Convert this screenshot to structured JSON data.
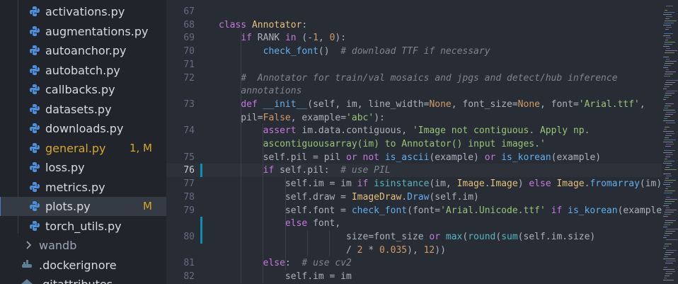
{
  "explorer": {
    "files": [
      {
        "name": "activations.py",
        "status": "",
        "color": "#d7dae0"
      },
      {
        "name": "augmentations.py",
        "status": "",
        "color": "#d7dae0"
      },
      {
        "name": "autoanchor.py",
        "status": "",
        "color": "#d7dae0"
      },
      {
        "name": "autobatch.py",
        "status": "",
        "color": "#d7dae0"
      },
      {
        "name": "callbacks.py",
        "status": "",
        "color": "#d7dae0"
      },
      {
        "name": "datasets.py",
        "status": "",
        "color": "#d7dae0"
      },
      {
        "name": "downloads.py",
        "status": "",
        "color": "#d7dae0"
      },
      {
        "name": "general.py",
        "status": "1, M",
        "color": "#d4a72c"
      },
      {
        "name": "loss.py",
        "status": "",
        "color": "#d7dae0"
      },
      {
        "name": "metrics.py",
        "status": "",
        "color": "#d7dae0"
      },
      {
        "name": "plots.py",
        "status": "M",
        "color": "#d7dae0"
      },
      {
        "name": "torch_utils.py",
        "status": "",
        "color": "#d7dae0"
      }
    ],
    "folder": "wandb",
    "dockerignore": ".dockerignore",
    "gitattributes": ".gitattributes"
  },
  "editor": {
    "current_line": "76",
    "lines": [
      {
        "num": "67",
        "parts": []
      },
      {
        "num": "68",
        "parts": [
          [
            "kw",
            "class "
          ],
          [
            "cl",
            "Annotator"
          ],
          [
            "tx",
            ":"
          ]
        ]
      },
      {
        "num": "69",
        "parts": [
          [
            "tx",
            "    "
          ],
          [
            "kw",
            "if "
          ],
          [
            "tx",
            "RANK "
          ],
          [
            "kw",
            "in "
          ],
          [
            "tx",
            "(-"
          ],
          [
            "nm",
            "1"
          ],
          [
            "tx",
            ", "
          ],
          [
            "nm",
            "0"
          ],
          [
            "tx",
            "):"
          ]
        ]
      },
      {
        "num": "70",
        "parts": [
          [
            "tx",
            "        "
          ],
          [
            "fn",
            "check_font"
          ],
          [
            "tx",
            "()  "
          ],
          [
            "cm",
            "# download TTF if necessary"
          ]
        ]
      },
      {
        "num": "71",
        "parts": []
      },
      {
        "num": "72",
        "parts": [
          [
            "tx",
            "    "
          ],
          [
            "cm",
            "#  Annotator for train/val mosaics and jpgs and detect/hub inference"
          ]
        ]
      },
      {
        "num": "",
        "parts": [
          [
            "tx",
            "    "
          ],
          [
            "cm",
            "annotations"
          ]
        ]
      },
      {
        "num": "73",
        "parts": [
          [
            "tx",
            "    "
          ],
          [
            "kw",
            "def "
          ],
          [
            "fn",
            "__init__"
          ],
          [
            "tx",
            "(self, im, line_width="
          ],
          [
            "nm",
            "None"
          ],
          [
            "tx",
            ", font_size="
          ],
          [
            "nm",
            "None"
          ],
          [
            "tx",
            ", font="
          ],
          [
            "st",
            "'Arial.ttf'"
          ],
          [
            "tx",
            ","
          ]
        ]
      },
      {
        "num": "",
        "parts": [
          [
            "tx",
            "    pil="
          ],
          [
            "nm",
            "False"
          ],
          [
            "tx",
            ", example="
          ],
          [
            "st",
            "'abc'"
          ],
          [
            "tx",
            "):"
          ]
        ]
      },
      {
        "num": "74",
        "parts": [
          [
            "tx",
            "        "
          ],
          [
            "kw",
            "assert "
          ],
          [
            "tx",
            "im.data.contiguous, "
          ],
          [
            "st",
            "'Image not contiguous. Apply np."
          ]
        ]
      },
      {
        "num": "",
        "parts": [
          [
            "tx",
            "        "
          ],
          [
            "st",
            "ascontiguousarray(im) to Annotator() input images.'"
          ]
        ]
      },
      {
        "num": "75",
        "parts": [
          [
            "tx",
            "        self.pil = pil "
          ],
          [
            "kw",
            "or not "
          ],
          [
            "fn",
            "is_ascii"
          ],
          [
            "tx",
            "(example) "
          ],
          [
            "kw",
            "or "
          ],
          [
            "fn",
            "is_korean"
          ],
          [
            "tx",
            "(example)"
          ]
        ]
      },
      {
        "num": "76",
        "parts": [
          [
            "tx",
            "        "
          ],
          [
            "kw",
            "if "
          ],
          [
            "tx",
            "self.pil:  "
          ],
          [
            "cm",
            "# use PIL"
          ]
        ]
      },
      {
        "num": "77",
        "parts": [
          [
            "tx",
            "            self.im = im "
          ],
          [
            "kw",
            "if "
          ],
          [
            "bi",
            "isinstance"
          ],
          [
            "tx",
            "(im, "
          ],
          [
            "cl",
            "Image"
          ],
          [
            "tx",
            "."
          ],
          [
            "cl",
            "Image"
          ],
          [
            "tx",
            ") "
          ],
          [
            "kw",
            "else "
          ],
          [
            "cl",
            "Image"
          ],
          [
            "tx",
            "."
          ],
          [
            "fn",
            "fromarray"
          ],
          [
            "tx",
            "(im)"
          ]
        ]
      },
      {
        "num": "78",
        "parts": [
          [
            "tx",
            "            self.draw = "
          ],
          [
            "cl",
            "ImageDraw"
          ],
          [
            "tx",
            "."
          ],
          [
            "fn",
            "Draw"
          ],
          [
            "tx",
            "(self.im)"
          ]
        ]
      },
      {
        "num": "79",
        "parts": [
          [
            "tx",
            "            self.font = "
          ],
          [
            "fn",
            "check_font"
          ],
          [
            "tx",
            "(font="
          ],
          [
            "st",
            "'Arial.Unicode.ttf'"
          ],
          [
            "kw",
            " if "
          ],
          [
            "fn",
            "is_korean"
          ],
          [
            "tx",
            "(example"
          ]
        ]
      },
      {
        "num": "",
        "parts": [
          [
            "tx",
            "            "
          ],
          [
            "kw",
            "else "
          ],
          [
            "tx",
            "font,"
          ]
        ]
      },
      {
        "num": "80",
        "parts": [
          [
            "tx",
            "                       size=font_size "
          ],
          [
            "kw",
            "or "
          ],
          [
            "bi",
            "max"
          ],
          [
            "tx",
            "("
          ],
          [
            "bi",
            "round"
          ],
          [
            "tx",
            "("
          ],
          [
            "bi",
            "sum"
          ],
          [
            "tx",
            "(self.im.size)"
          ]
        ]
      },
      {
        "num": "",
        "parts": [
          [
            "tx",
            "                       / "
          ],
          [
            "nm",
            "2"
          ],
          [
            "tx",
            " * "
          ],
          [
            "nm",
            "0.035"
          ],
          [
            "tx",
            "), "
          ],
          [
            "nm",
            "12"
          ],
          [
            "tx",
            "))"
          ]
        ]
      },
      {
        "num": "81",
        "parts": [
          [
            "tx",
            "        "
          ],
          [
            "kw",
            "else"
          ],
          [
            "tx",
            ":  "
          ],
          [
            "cm",
            "# use cv2"
          ]
        ]
      },
      {
        "num": "82",
        "parts": [
          [
            "tx",
            "            self.im = im"
          ]
        ]
      }
    ]
  },
  "colors": {
    "keyword": "#c678dd",
    "function": "#61afef",
    "string": "#98c379",
    "comment": "#7f848e",
    "number": "#d19a66",
    "class": "#e5c07b",
    "git_modified": "#0e8fb0"
  }
}
